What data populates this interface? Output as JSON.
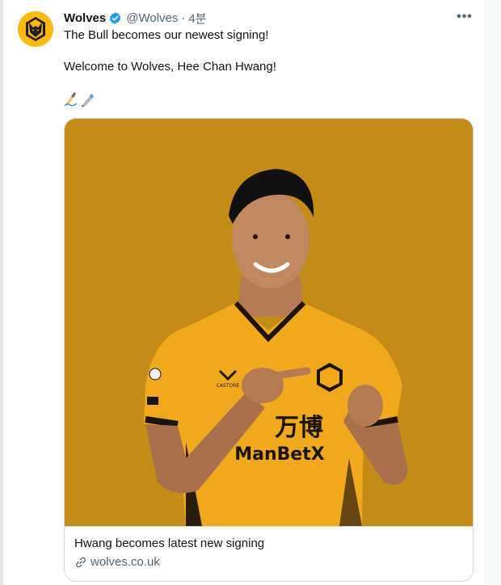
{
  "tweet": {
    "author_name": "Wolves",
    "author_handle": "@Wolves",
    "separator": "·",
    "time": "4분",
    "more_label": "•••",
    "text_line1": "The Bull becomes our newest signing!",
    "text_line2": "Welcome to Wolves, Hee Chan Hwang!",
    "emojis": [
      "writing-hand-emoji",
      "pen-emoji"
    ]
  },
  "card": {
    "title": "Hwang becomes latest new signing",
    "domain": "wolves.co.uk"
  },
  "photo": {
    "shirt_sponsor_line1": "万博",
    "shirt_sponsor_line2": "ManBetX",
    "shirt_brand": "CASTORE"
  },
  "colors": {
    "brand_gold": "#fdb913",
    "photo_bg": "#c48b16",
    "verified_blue": "#1d9bf0",
    "text_primary": "#0f1419",
    "text_secondary": "#536471"
  }
}
